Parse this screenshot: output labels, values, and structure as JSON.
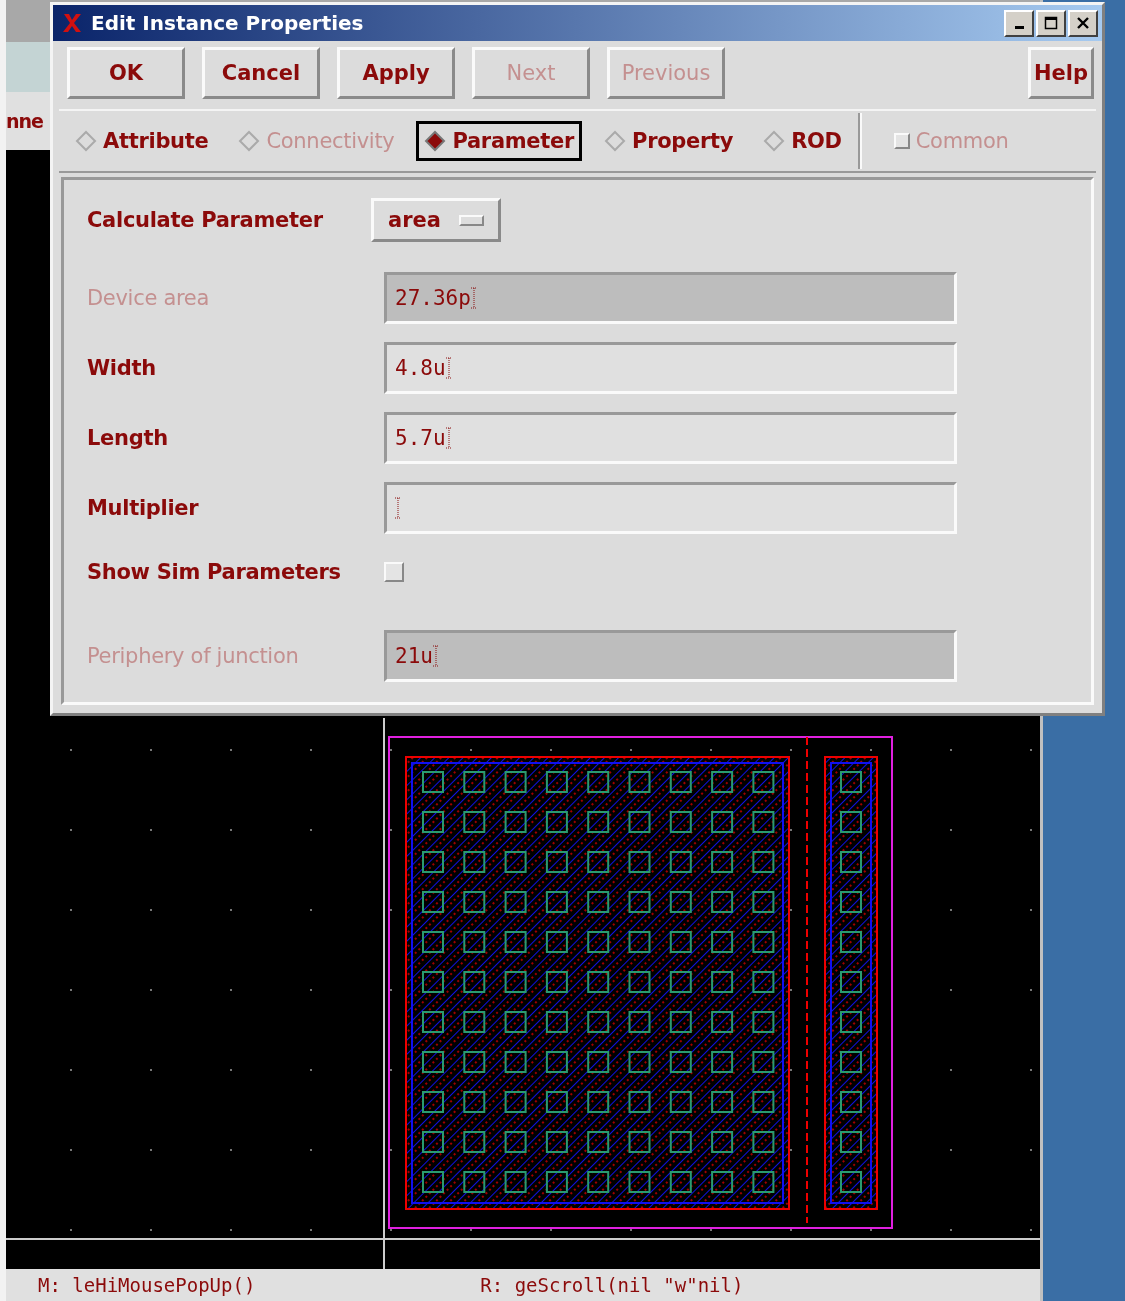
{
  "background": {
    "partial_label": "nne",
    "status_bar": {
      "left": "M: leHiMousePopUp()",
      "right": "R: geScroll(nil \"w\"nil)"
    }
  },
  "window": {
    "title": "Edit Instance Properties"
  },
  "buttons": [
    {
      "label": "OK",
      "disabled": false
    },
    {
      "label": "Cancel",
      "disabled": false
    },
    {
      "label": "Apply",
      "disabled": false
    },
    {
      "label": "Next",
      "disabled": true
    },
    {
      "label": "Previous",
      "disabled": true
    }
  ],
  "help_button": {
    "label": "Help"
  },
  "tabs": [
    {
      "label": "Attribute",
      "selected": false,
      "disabled": false
    },
    {
      "label": "Connectivity",
      "selected": false,
      "disabled": true
    },
    {
      "label": "Parameter",
      "selected": true,
      "disabled": false
    },
    {
      "label": "Property",
      "selected": false,
      "disabled": false
    },
    {
      "label": "ROD",
      "selected": false,
      "disabled": false
    }
  ],
  "common": {
    "label": "Common",
    "checked": false,
    "disabled": true
  },
  "form": [
    {
      "kind": "dropdown",
      "label": "Calculate Parameter",
      "value": "area",
      "disabled": false
    },
    {
      "kind": "field",
      "label": "Device area",
      "value": "27.36p",
      "disabled": true
    },
    {
      "kind": "field",
      "label": "Width",
      "value": "4.8u",
      "disabled": false
    },
    {
      "kind": "field",
      "label": "Length",
      "value": "5.7u",
      "disabled": false
    },
    {
      "kind": "field",
      "label": "Multiplier",
      "disabled": false
    },
    {
      "kind": "checkbox",
      "label": "Show Sim Parameters",
      "checked": false,
      "disabled": false
    },
    {
      "kind": "field",
      "label": "Periphery of junction",
      "value": "21u",
      "disabled": true
    }
  ]
}
